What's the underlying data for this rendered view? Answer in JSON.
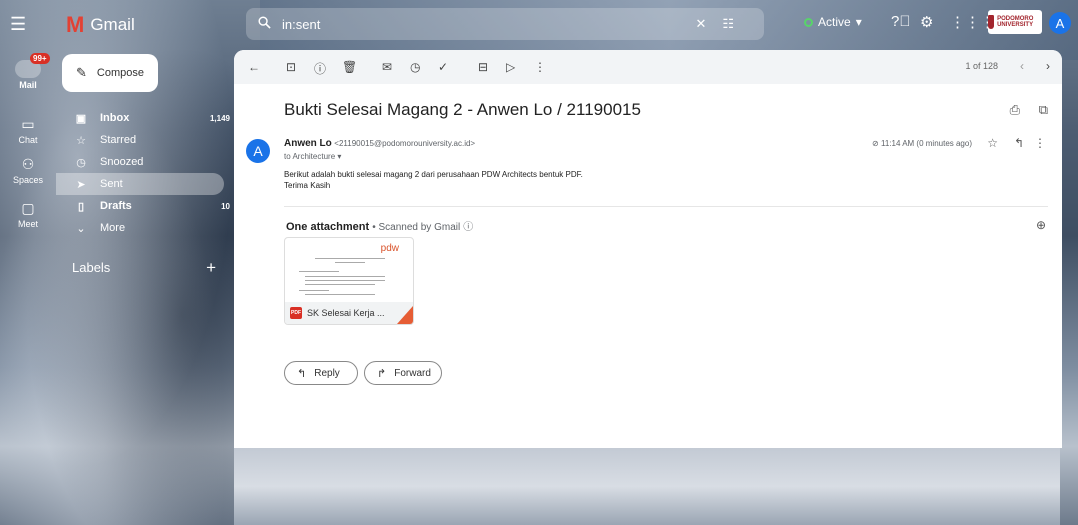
{
  "app": {
    "name": "Gmail"
  },
  "search": {
    "query": "in:sent"
  },
  "status": {
    "label": "Active"
  },
  "university": {
    "logo_text": "PODOMORO UNIVERSITY"
  },
  "user": {
    "initial": "A"
  },
  "rail": [
    {
      "label": "Mail",
      "badge": "99+"
    },
    {
      "label": "Chat"
    },
    {
      "label": "Spaces"
    },
    {
      "label": "Meet"
    }
  ],
  "compose": {
    "label": "Compose"
  },
  "nav": [
    {
      "label": "Inbox",
      "count": "1,149"
    },
    {
      "label": "Starred",
      "count": ""
    },
    {
      "label": "Snoozed",
      "count": ""
    },
    {
      "label": "Sent",
      "count": ""
    },
    {
      "label": "Drafts",
      "count": "10"
    },
    {
      "label": "More",
      "count": ""
    }
  ],
  "labels": {
    "title": "Labels"
  },
  "toolbar": {
    "pager": "1 of 128"
  },
  "email": {
    "subject": "Bukti Selesai Magang 2 - Anwen Lo / 21190015",
    "sender_name": "Anwen Lo",
    "sender_email": "<21190015@podomorouniversity.ac.id>",
    "to": "to Architecture",
    "time": "11:14 AM (0 minutes ago)",
    "body_line1": "Berikut adalah bukti selesai magang 2 dari perusahaan PDW Architects bentuk PDF.",
    "body_line2": "Terima Kasih"
  },
  "attachment": {
    "heading": "One attachment",
    "scanned": "Scanned by Gmail",
    "brand": "pdw",
    "file_name": "SK Selesai Kerja ..."
  },
  "actions": {
    "reply": "Reply",
    "forward": "Forward"
  },
  "colors": {
    "accent": "#1a73e8",
    "badge": "#d93025",
    "active": "#58d46a"
  }
}
